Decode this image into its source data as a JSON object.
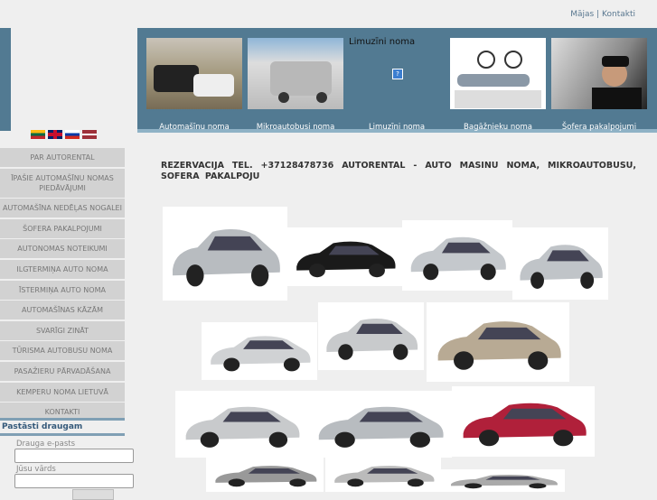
{
  "top_links": {
    "home": "Mājas",
    "separator": "|",
    "contacts": "Kontakti"
  },
  "banner": [
    {
      "label": "Automašīnu noma"
    },
    {
      "label": "Mikroautobusi noma"
    },
    {
      "label": "Limuzīni noma",
      "title": "Limuzīni noma"
    },
    {
      "label": "Bagāžnieku noma"
    },
    {
      "label": "Šofera pakalpojumi"
    }
  ],
  "flags": [
    "lithuanian",
    "english",
    "russian",
    "latvian"
  ],
  "menu": [
    "Par autorental",
    "Īpašie automašīnu nomas piedāvājumi",
    "Automašīna nedēļas nogalei",
    "Šofera pakalpojumi",
    "Autonomas noteikumi",
    "Ilgtermiņa auto noma",
    "Īstermiņa auto noma",
    "Automašīnas kāzām",
    "Svarīgi zināt",
    "Tūrisma autobusu noma",
    "Pasažieru pārvadāšana",
    "Kemperu noma Lietuvā",
    "Kontakti"
  ],
  "tell_friend": {
    "title": "Pastāsti draugam",
    "email_label": "Drauga e-pasts",
    "name_label": "Jūsu vārds"
  },
  "reservation": "REZERVACIJA TEL. +37128478736 AUTORENTAL - AUTO MASINU NOMA, MIKROAUTOBUSU, SOFERA PAKALPOJU",
  "colors": {
    "banner": "#527a92",
    "menu": "#d2d2d2"
  }
}
